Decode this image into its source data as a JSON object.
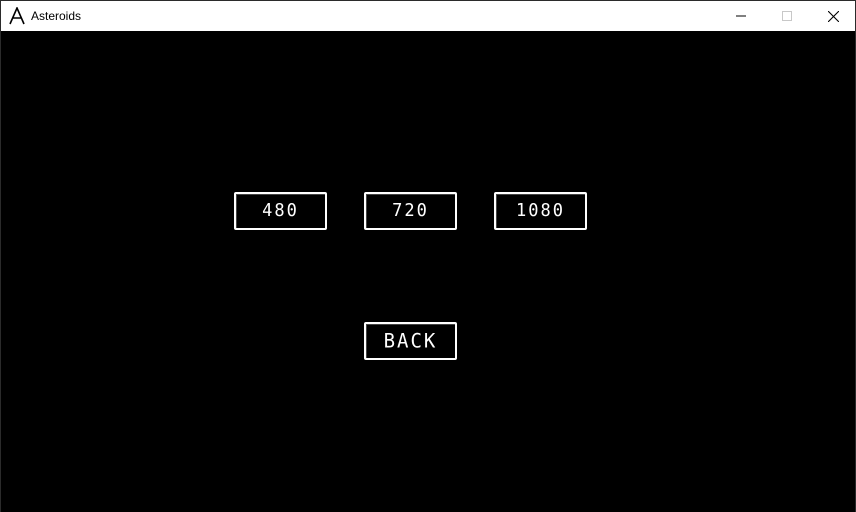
{
  "window": {
    "title": "Asteroids",
    "app_icon": "asteroids-a-icon",
    "controls": {
      "minimize": "minimize-icon",
      "maximize": "maximize-icon",
      "close": "close-icon"
    }
  },
  "menu": {
    "resolutions": [
      {
        "label": "480"
      },
      {
        "label": "720"
      },
      {
        "label": "1080"
      }
    ],
    "back_label": "BACK"
  },
  "colors": {
    "background": "#000000",
    "foreground": "#ffffff",
    "titlebar": "#ffffff"
  }
}
